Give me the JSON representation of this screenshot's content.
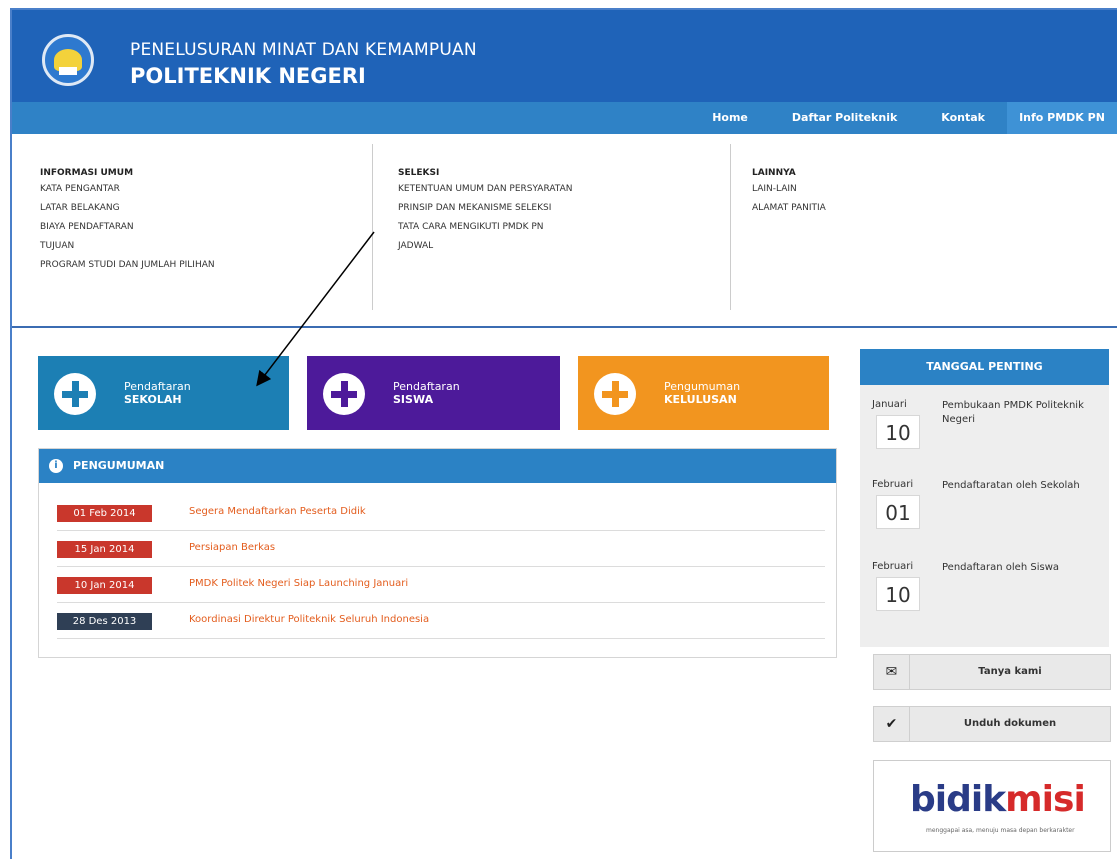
{
  "header": {
    "title_line1": "PENELUSURAN MINAT DAN KEMAMPUAN",
    "title_line2": "POLITEKNIK NEGERI"
  },
  "nav": {
    "items": [
      "Home",
      "Daftar Politeknik",
      "Kontak",
      "Info PMDK PN"
    ],
    "active": "Info PMDK PN"
  },
  "mega_menu": {
    "columns": [
      {
        "heading": "INFORMASI UMUM",
        "links": [
          "KATA PENGANTAR",
          "LATAR BELAKANG",
          "BIAYA PENDAFTARAN",
          "TUJUAN",
          "PROGRAM STUDI DAN JUMLAH PILIHAN"
        ]
      },
      {
        "heading": "SELEKSI",
        "links": [
          "KETENTUAN UMUM DAN PERSYARATAN",
          "PRINSIP DAN MEKANISME SELEKSI",
          "TATA CARA MENGIKUTI PMDK PN",
          "JADWAL"
        ]
      },
      {
        "heading": "LAINNYA",
        "links": [
          "LAIN-LAIN",
          "ALAMAT PANITIA"
        ]
      }
    ]
  },
  "actions": [
    {
      "line1": "Pendaftaran",
      "line2": "SEKOLAH",
      "color": "#1c7fb4"
    },
    {
      "line1": "Pendaftaran",
      "line2": "SISWA",
      "color": "#4d1a9a"
    },
    {
      "line1": "Pengumuman",
      "line2": "KELULUSAN",
      "color": "#f2951f"
    }
  ],
  "announcements": {
    "title": "PENGUMUMAN",
    "items": [
      {
        "date": "01 Feb 2014",
        "title": "Segera Mendaftarkan Peserta Didik",
        "badge_color": "#c9372c"
      },
      {
        "date": "15 Jan 2014",
        "title": "Persiapan Berkas",
        "badge_color": "#c9372c"
      },
      {
        "date": "10 Jan 2014",
        "title": "PMDK Politek Negeri Siap Launching Januari",
        "badge_color": "#c9372c"
      },
      {
        "date": "28 Des 2013",
        "title": "Koordinasi Direktur Politeknik Seluruh Indonesia",
        "badge_color": "#2f3f55"
      }
    ]
  },
  "important_dates": {
    "title": "TANGGAL PENTING",
    "events": [
      {
        "month": "Januari",
        "day": "10",
        "desc": "Pembukaan PMDK Politeknik Negeri"
      },
      {
        "month": "Februari",
        "day": "01",
        "desc": "Pendaftaratan oleh Sekolah"
      },
      {
        "month": "Februari",
        "day": "10",
        "desc": "Pendaftaran oleh Siswa"
      }
    ]
  },
  "side_buttons": [
    {
      "label": "Tanya kami",
      "icon": "mail-icon",
      "glyph": "✉"
    },
    {
      "label": "Unduh dokumen",
      "icon": "check-icon",
      "glyph": "✔"
    }
  ],
  "bidikmisi": {
    "logo_bidik": "bidik",
    "logo_misi": "misi",
    "tagline": "menggapai asa, menuju masa depan berkarakter"
  }
}
